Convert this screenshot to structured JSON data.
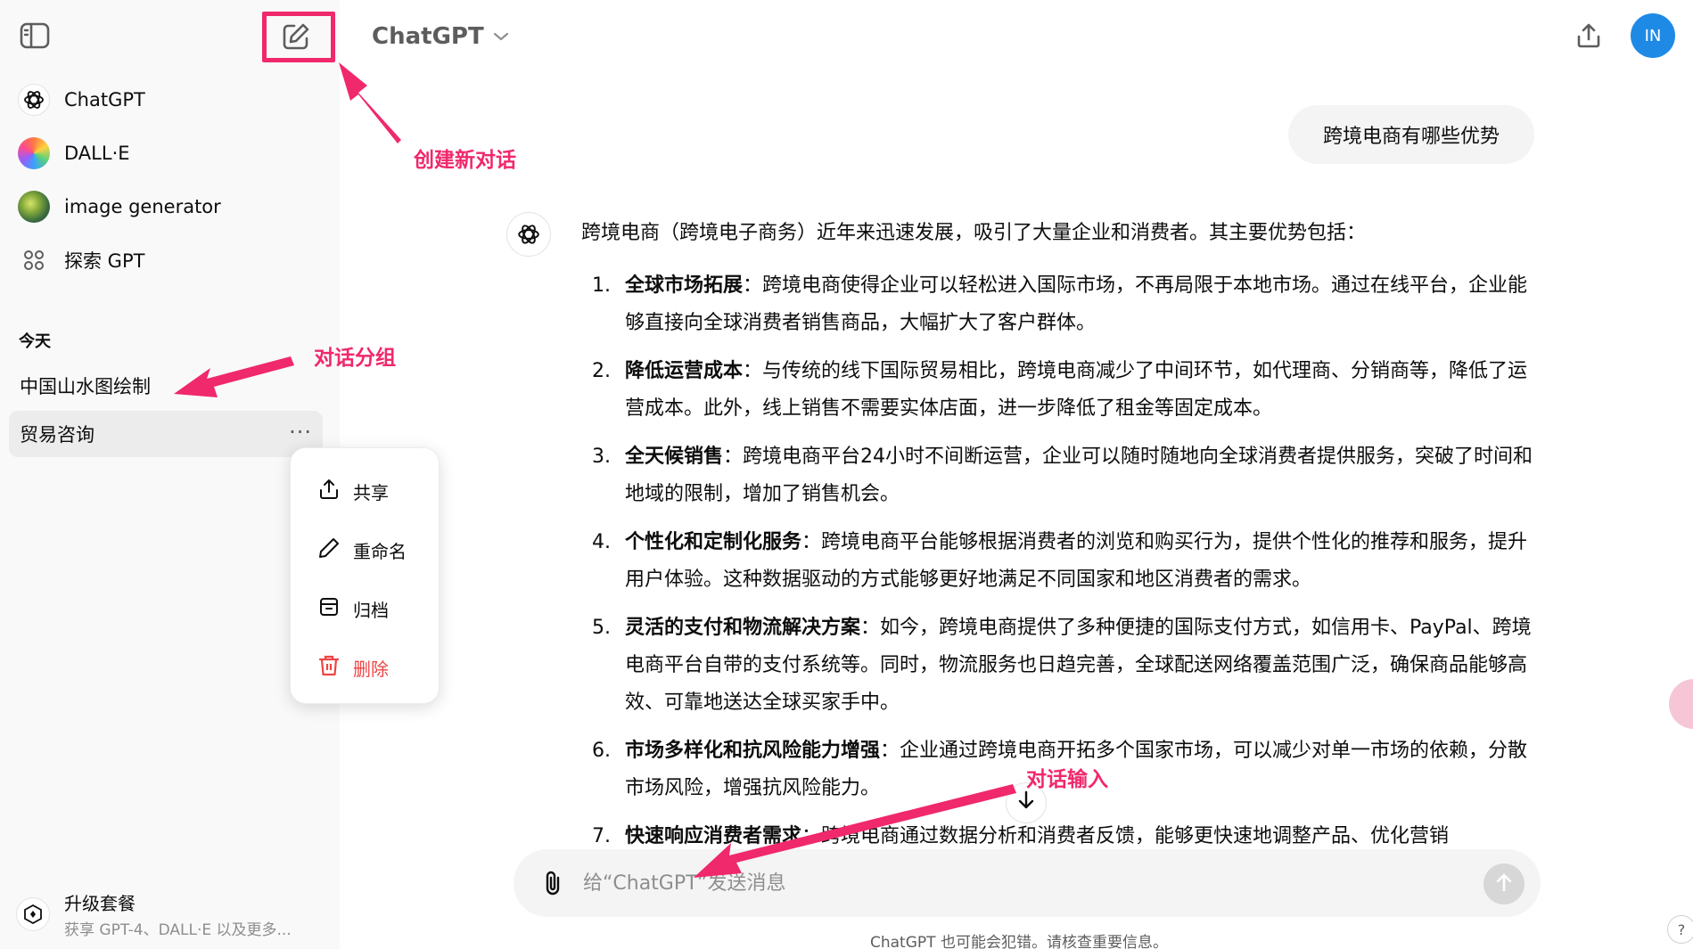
{
  "sidebar": {
    "gpts": [
      {
        "label": "ChatGPT",
        "icon": "chatgpt-logo-icon"
      },
      {
        "label": "DALL·E",
        "icon": "dalle-icon"
      },
      {
        "label": "image generator",
        "icon": "image-generator-icon"
      },
      {
        "label": "探索 GPT",
        "icon": "explore-grid-icon"
      }
    ],
    "section_today": "今天",
    "chats": [
      {
        "label": "中国山水图绘制"
      },
      {
        "label": "贸易咨询",
        "more": "···"
      }
    ],
    "upgrade": {
      "title": "升级套餐",
      "subtitle": "获享 GPT-4、DALL·E 以及更多..."
    }
  },
  "context_menu": {
    "items": [
      {
        "label": "共享",
        "icon": "share-icon"
      },
      {
        "label": "重命名",
        "icon": "pencil-icon"
      },
      {
        "label": "归档",
        "icon": "archive-icon"
      },
      {
        "label": "删除",
        "icon": "trash-icon",
        "danger": true
      }
    ]
  },
  "header": {
    "model": "ChatGPT",
    "avatar_initials": "IN"
  },
  "conversation": {
    "user_message": "跨境电商有哪些优势",
    "assistant_intro": "跨境电商（跨境电子商务）近年来迅速发展，吸引了大量企业和消费者。其主要优势包括：",
    "points": [
      {
        "num": "1.",
        "title": "全球市场拓展",
        "text": "：跨境电商使得企业可以轻松进入国际市场，不再局限于本地市场。通过在线平台，企业能够直接向全球消费者销售商品，大幅扩大了客户群体。"
      },
      {
        "num": "2.",
        "title": "降低运营成本",
        "text": "：与传统的线下国际贸易相比，跨境电商减少了中间环节，如代理商、分销商等，降低了运营成本。此外，线上销售不需要实体店面，进一步降低了租金等固定成本。"
      },
      {
        "num": "3.",
        "title": "全天候销售",
        "text": "：跨境电商平台24小时不间断运营，企业可以随时随地向全球消费者提供服务，突破了时间和地域的限制，增加了销售机会。"
      },
      {
        "num": "4.",
        "title": "个性化和定制化服务",
        "text": "：跨境电商平台能够根据消费者的浏览和购买行为，提供个性化的推荐和服务，提升用户体验。这种数据驱动的方式能够更好地满足不同国家和地区消费者的需求。"
      },
      {
        "num": "5.",
        "title": "灵活的支付和物流解决方案",
        "text": "：如今，跨境电商提供了多种便捷的国际支付方式，如信用卡、PayPal、跨境电商平台自带的支付系统等。同时，物流服务也日趋完善，全球配送网络覆盖范围广泛，确保商品能够高效、可靠地送达全球买家手中。"
      },
      {
        "num": "6.",
        "title": "市场多样化和抗风险能力增强",
        "text": "：企业通过跨境电商开拓多个国家市场，可以减少对单一市场的依赖，分散市场风险，增强抗风险能力。"
      },
      {
        "num": "7.",
        "title": "快速响应消费者需求",
        "text": "：跨境电商通过数据分析和消费者反馈，能够更快速地调整产品、优化营销"
      }
    ]
  },
  "composer": {
    "placeholder": "给“ChatGPT”发送消息",
    "value": ""
  },
  "footer": {
    "disclaimer": "ChatGPT 也可能会犯错。请核查重要信息。",
    "help": "?"
  },
  "annotations": {
    "new_chat": "创建新对话",
    "chat_group": "对话分组",
    "chat_input": "对话输入"
  },
  "colors": {
    "annotation": "#f0286c",
    "avatar": "#1f8ae6",
    "danger": "#ef4444",
    "sidebar_bg": "#f9f9f9"
  }
}
